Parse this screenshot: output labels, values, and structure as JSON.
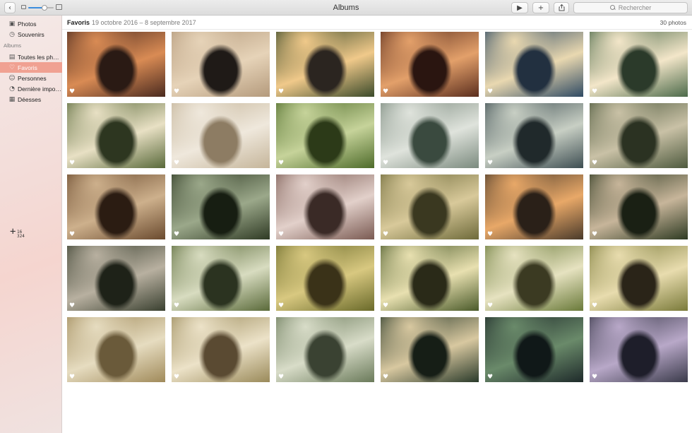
{
  "window": {
    "title": "Albums"
  },
  "toolbar": {
    "back_icon": "chevron-left-icon",
    "zoom_slider_level": 0.65,
    "play_icon": "play-icon",
    "add_icon": "plus-icon",
    "share_icon": "share-icon",
    "search_placeholder": "Rechercher"
  },
  "sidebar": {
    "top_items": [
      {
        "label": "Photos",
        "icon": "photos-icon"
      },
      {
        "label": "Souvenirs",
        "icon": "memories-icon"
      }
    ],
    "section_label": "Albums",
    "album_items": [
      {
        "label": "Toutes les ph…",
        "icon": "all-photos-icon",
        "selected": false
      },
      {
        "label": "Favoris",
        "icon": "heart-icon",
        "selected": true
      },
      {
        "label": "Personnes",
        "icon": "people-icon",
        "selected": false
      },
      {
        "label": "Dernière impo…",
        "icon": "clock-icon",
        "selected": false
      },
      {
        "label": "Déesses",
        "icon": "album-icon",
        "selected": false
      }
    ],
    "cursor_readout": [
      "16",
      "324"
    ]
  },
  "main": {
    "album_name": "Favoris",
    "date_range": "19 octobre 2016 – 8 septembre 2017",
    "photo_count": "30 photos"
  },
  "photos": [
    {
      "colors": [
        "#4a2a1f",
        "#d98b54",
        "#2a1a14"
      ],
      "favorite": true
    },
    {
      "colors": [
        "#b49a7c",
        "#e6d3b8",
        "#1f1a17"
      ],
      "favorite": true
    },
    {
      "colors": [
        "#3b4a2a",
        "#f0c98a",
        "#2b2520"
      ],
      "favorite": true
    },
    {
      "colors": [
        "#5b2e1e",
        "#e3a06a",
        "#2a1510"
      ],
      "favorite": true
    },
    {
      "colors": [
        "#2f4a63",
        "#e9d8b0",
        "#223040"
      ],
      "favorite": true
    },
    {
      "colors": [
        "#4c6a4a",
        "#f3e6c9",
        "#2b3a2a"
      ],
      "favorite": true
    },
    {
      "colors": [
        "#59693a",
        "#e8e0c4",
        "#2d3620"
      ],
      "favorite": true
    },
    {
      "colors": [
        "#c5b59a",
        "#efe8dc",
        "#8d7c63"
      ],
      "favorite": true
    },
    {
      "colors": [
        "#4e6b2a",
        "#c6d39a",
        "#2c3a18"
      ],
      "favorite": true
    },
    {
      "colors": [
        "#7b8a7e",
        "#dfe3dc",
        "#3a4a3f"
      ],
      "favorite": true
    },
    {
      "colors": [
        "#3e4e52",
        "#c8cfc4",
        "#20292b"
      ],
      "favorite": true
    },
    {
      "colors": [
        "#4e5a3e",
        "#c9c1a6",
        "#2b3222"
      ],
      "favorite": true
    },
    {
      "colors": [
        "#6a4a2e",
        "#cdb08c",
        "#2b1c12"
      ],
      "favorite": true
    },
    {
      "colors": [
        "#2f3a24",
        "#9ba88a",
        "#171e12"
      ],
      "favorite": true
    },
    {
      "colors": [
        "#7a5a52",
        "#e2d0ca",
        "#3a2a26"
      ],
      "favorite": true
    },
    {
      "colors": [
        "#6e6a3a",
        "#d8c99a",
        "#3a3820"
      ],
      "favorite": true
    },
    {
      "colors": [
        "#4a3a2a",
        "#e8a868",
        "#2a2018"
      ],
      "favorite": true
    },
    {
      "colors": [
        "#2e3a22",
        "#c7b59a",
        "#1a2014"
      ],
      "favorite": true
    },
    {
      "colors": [
        "#3a4030",
        "#b8b0a0",
        "#1e2218"
      ],
      "favorite": true
    },
    {
      "colors": [
        "#5a6a3a",
        "#d8dcc0",
        "#2b3320"
      ],
      "favorite": true
    },
    {
      "colors": [
        "#6a6a2a",
        "#d8c880",
        "#3a3218"
      ],
      "favorite": true
    },
    {
      "colors": [
        "#4a5a2a",
        "#e8e0b0",
        "#2a2a18"
      ],
      "favorite": true
    },
    {
      "colors": [
        "#6a7a3a",
        "#e6e2c0",
        "#3b3a22"
      ],
      "favorite": true
    },
    {
      "colors": [
        "#7a7a3a",
        "#e8dcae",
        "#2a2418"
      ],
      "favorite": true
    },
    {
      "colors": [
        "#a08a5a",
        "#e6dcc0",
        "#6a5a3a"
      ],
      "favorite": true
    },
    {
      "colors": [
        "#9a8a5a",
        "#ece2c8",
        "#5a4a32"
      ],
      "favorite": true
    },
    {
      "colors": [
        "#6a7a5a",
        "#d8dcc8",
        "#3a4232"
      ],
      "favorite": true
    },
    {
      "colors": [
        "#2a3a2a",
        "#d8c8a0",
        "#161e16"
      ],
      "favorite": true
    },
    {
      "colors": [
        "#1e2a2a",
        "#6a8a6a",
        "#101818"
      ],
      "favorite": true
    },
    {
      "colors": [
        "#3a3a4a",
        "#b8a8c8",
        "#1e1e2a"
      ],
      "favorite": true
    }
  ]
}
